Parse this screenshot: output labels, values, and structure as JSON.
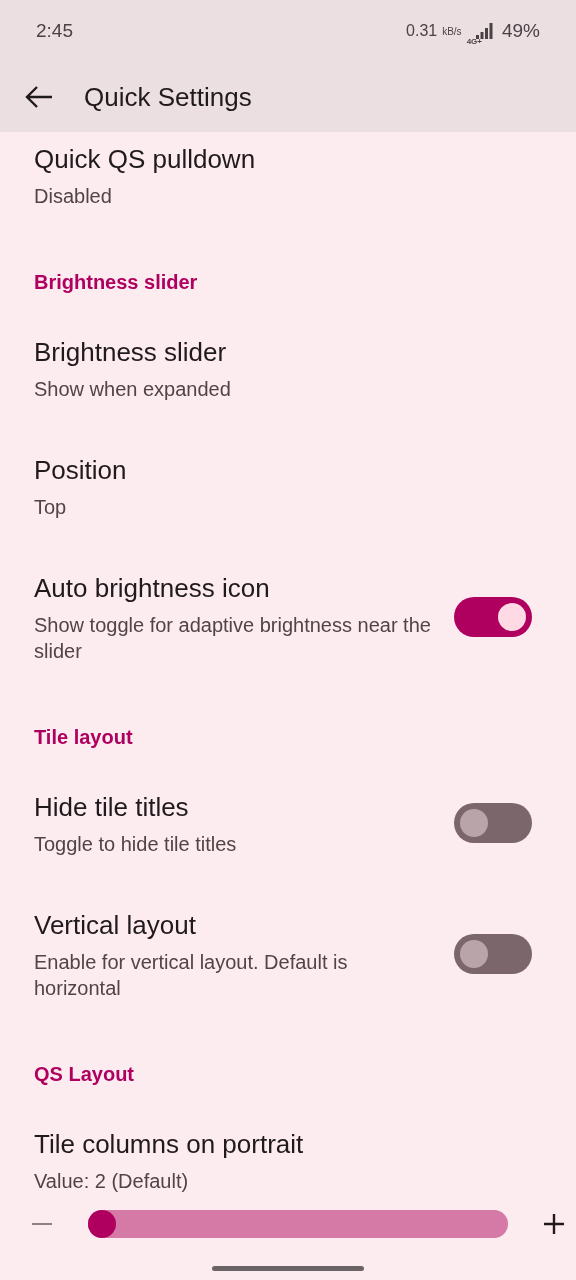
{
  "status_bar": {
    "time": "2:45",
    "speed": "0.31",
    "speed_unit": "kB/s",
    "network": "4G+",
    "battery": "49%"
  },
  "app_bar": {
    "title": "Quick Settings"
  },
  "items": [
    {
      "kind": "item",
      "title": "Quick QS pulldown",
      "summary": "Disabled"
    },
    {
      "kind": "header",
      "title": "Brightness slider"
    },
    {
      "kind": "item",
      "title": "Brightness slider",
      "summary": "Show when expanded"
    },
    {
      "kind": "item",
      "title": "Position",
      "summary": "Top"
    },
    {
      "kind": "switch",
      "title": "Auto brightness icon",
      "summary": "Show toggle for adaptive brightness near the slider",
      "on": true
    },
    {
      "kind": "header",
      "title": "Tile layout"
    },
    {
      "kind": "switch",
      "title": "Hide tile titles",
      "summary": "Toggle to hide tile titles",
      "on": false
    },
    {
      "kind": "switch",
      "title": "Vertical layout",
      "summary": "Enable for vertical layout. Default is horizontal",
      "on": false
    },
    {
      "kind": "header",
      "title": "QS Layout"
    },
    {
      "kind": "slider",
      "title": "Tile columns on portrait",
      "summary": "Value: 2 (Default)",
      "level": 0.0
    }
  ]
}
